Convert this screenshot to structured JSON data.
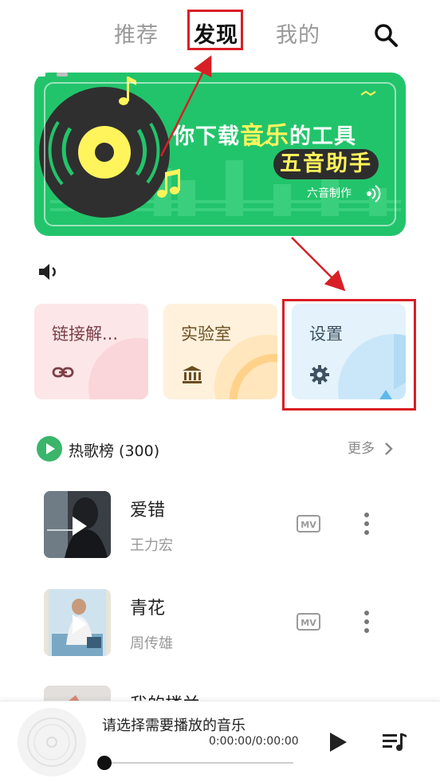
{
  "tabs": [
    {
      "label": "推荐",
      "active": false
    },
    {
      "label": "发现",
      "active": true
    },
    {
      "label": "我的",
      "active": false
    }
  ],
  "banner": {
    "line1_prefix": "你下载",
    "line1_highlight": "音乐",
    "line1_suffix": "的工具",
    "pill_text": "五音助手",
    "brand": "六音制作"
  },
  "cards": [
    {
      "label": "链接解...",
      "icon": "link-icon"
    },
    {
      "label": "实验室",
      "icon": "bank-icon"
    },
    {
      "label": "设置",
      "icon": "gear-icon"
    }
  ],
  "hot_list": {
    "title": "热歌榜 (300)",
    "more_label": "更多"
  },
  "songs": [
    {
      "title": "爱错",
      "artist": "王力宏",
      "mv": "MV"
    },
    {
      "title": "青花",
      "artist": "周传雄",
      "mv": "MV"
    },
    {
      "title": "我的楼兰",
      "artist": "",
      "mv": ""
    }
  ],
  "player": {
    "now_playing": "请选择需要播放的音乐",
    "time": "0:00:00/0:00:00",
    "progress": 0
  },
  "colors": {
    "banner_green": "#22c46b",
    "highlight_yellow": "#fff45c",
    "annotation_red": "#d81f26",
    "hot_green": "#3ab56a"
  }
}
